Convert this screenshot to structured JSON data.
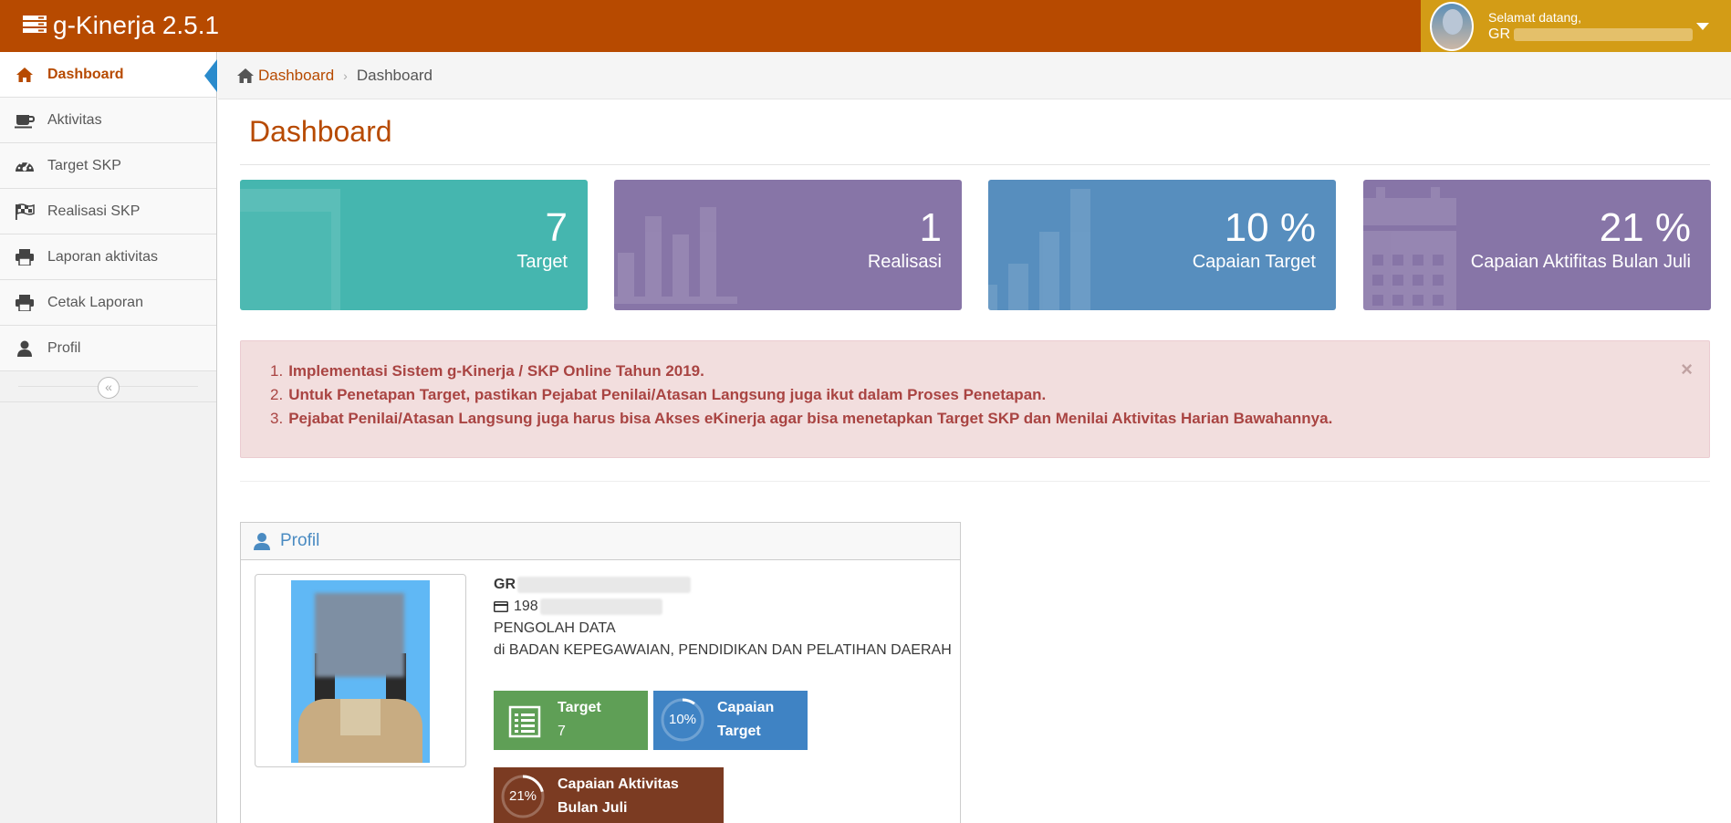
{
  "navbar": {
    "brand": "g-Kinerja 2.5.1",
    "welcome": "Selamat datang,",
    "user_name": "GR"
  },
  "sidebar": {
    "items": [
      {
        "label": "Dashboard",
        "icon": "home-icon",
        "active": true
      },
      {
        "label": "Aktivitas",
        "icon": "coffee-icon"
      },
      {
        "label": "Target SKP",
        "icon": "dashboard-gauge-icon"
      },
      {
        "label": "Realisasi SKP",
        "icon": "flag-checkered-icon"
      },
      {
        "label": "Laporan aktivitas",
        "icon": "print-icon"
      },
      {
        "label": "Cetak Laporan",
        "icon": "print-icon"
      },
      {
        "label": "Profil",
        "icon": "user-icon"
      }
    ],
    "collapse_icon": "«"
  },
  "breadcrumb": {
    "home": "Dashboard",
    "separator": "›",
    "current": "Dashboard"
  },
  "page": {
    "title": "Dashboard"
  },
  "stats": [
    {
      "value": "7",
      "label": "Target",
      "color": "#45b6af",
      "icon": "table-icon"
    },
    {
      "value": "1",
      "label": "Realisasi",
      "color": "#8775a7",
      "icon": "bar-chart-icon"
    },
    {
      "value": "10 %",
      "label": "Capaian Target",
      "color": "#578ebe",
      "icon": "signal-icon"
    },
    {
      "value": "21 %",
      "label": "Capaian Aktifitas Bulan Juli",
      "color": "#8775a7",
      "icon": "calendar-icon"
    }
  ],
  "alert": {
    "items": [
      {
        "num": "1.",
        "text": "Implementasi Sistem g-Kinerja / SKP Online Tahun 2019."
      },
      {
        "num": "2.",
        "text": "Untuk Penetapan Target, pastikan Pejabat Penilai/Atasan Langsung juga ikut dalam Proses Penetapan."
      },
      {
        "num": "3.",
        "text": "Pejabat Penilai/Atasan Langsung juga harus bisa Akses eKinerja agar bisa menetapkan Target SKP dan Menilai Aktivitas Harian Bawahannya."
      }
    ],
    "close": "×"
  },
  "profile": {
    "title": "Profil",
    "name": "GR",
    "nip": "198",
    "position": "PENGOLAH DATA",
    "unit": "di BADAN KEPEGAWAIAN, PENDIDIKAN DAN PELATIHAN DAERAH",
    "tiles": {
      "target_label": "Target",
      "target_value": "7",
      "capaian_percent": "10%",
      "capaian_label_1": "Capaian",
      "capaian_label_2": "Target",
      "aktivitas_percent": "21%",
      "aktivitas_label_1": "Capaian Aktivitas",
      "aktivitas_label_2": "Bulan Juli"
    },
    "tile_colors": {
      "target": "#5f9f56",
      "capaian": "#3f83c4",
      "aktivitas": "#7b3b22"
    },
    "capaian_progress": 0.1,
    "aktivitas_progress": 0.21
  },
  "colors": {
    "brand": "#b74a00",
    "user_box": "#d39c16",
    "link_blue": "#4a8bc2"
  }
}
